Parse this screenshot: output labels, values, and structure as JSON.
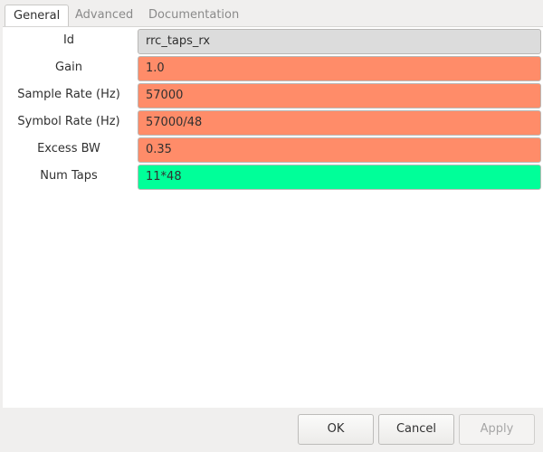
{
  "tabs": [
    {
      "label": "General",
      "active": true
    },
    {
      "label": "Advanced",
      "active": false
    },
    {
      "label": "Documentation",
      "active": false
    }
  ],
  "fields": [
    {
      "label": "Id",
      "value": "rrc_taps_rx",
      "bg": "#dcdcdc"
    },
    {
      "label": "Gain",
      "value": "1.0",
      "bg": "#ff8c69"
    },
    {
      "label": "Sample Rate (Hz)",
      "value": "57000",
      "bg": "#ff8c69"
    },
    {
      "label": "Symbol Rate (Hz)",
      "value": "57000/48",
      "bg": "#ff8c69"
    },
    {
      "label": "Excess BW",
      "value": "0.35",
      "bg": "#ff8c69"
    },
    {
      "label": "Num Taps",
      "value": "11*48",
      "bg": "#00ff99"
    }
  ],
  "buttons": {
    "ok": "OK",
    "cancel": "Cancel",
    "apply": "Apply"
  }
}
